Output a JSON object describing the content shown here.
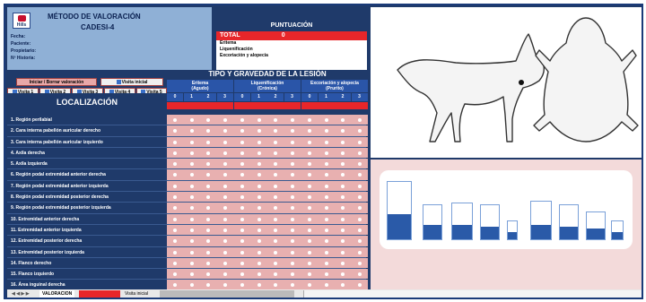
{
  "header": {
    "title": "MÉTODO DE VALORACIÓN",
    "subtitle": "CADESI-4",
    "logo_text": "Hills",
    "patient_info": [
      "Fecha:",
      "Paciente:",
      "Propietario:",
      "Nº Historia:"
    ]
  },
  "score": {
    "title": "PUNTUACIÓN",
    "total_label": "TOTAL",
    "total_value": "0",
    "items": [
      "Eritema",
      "Liquenificación",
      "Excoriación y alopecia"
    ]
  },
  "buttons": {
    "reset": "Iniciar / Borrar valoración",
    "initial": "Visita inicial",
    "visits": [
      "Visita 1",
      "Visita 2",
      "Visita 3",
      "Visita 4",
      "Visita 5"
    ]
  },
  "location_header": "LOCALIZACIÓN",
  "lesion_header": "TIPO Y GRAVEDAD DE LA LESIÓN",
  "groups": [
    {
      "name": "Eritema",
      "sub": "(Agudo)"
    },
    {
      "name": "Liquenificación",
      "sub": "(Crónica)"
    },
    {
      "name": "Excoriación y alopecia",
      "sub": "(Prurito)"
    }
  ],
  "scale": [
    "0",
    "1",
    "2",
    "3"
  ],
  "regions": [
    "1. Región perilabial",
    "2. Cara interna pabellón auricular derecho",
    "3. Cara interna pabellón auricular izquierdo",
    "4. Axila derecha",
    "5. Axila izquierda",
    "6. Región podal extremidad anterior derecha",
    "7. Región podal extremidad anterior izquierda",
    "8. Región podal extremidad posterior derecha",
    "9. Región podal extremidad posterior izquierda",
    "10. Extremidad anterior derecha",
    "11. Extremidad anterior izquierda",
    "12. Extremidad posterior derecha",
    "13. Extremidad posterior izquierda",
    "14. Flanco derecho",
    "15. Flanco izquierdo",
    "16. Área inguinal derecha"
  ],
  "sheet_tabs": [
    "VALORACION",
    "Visita inicial"
  ],
  "colors": {
    "navy": "#1f3a6a",
    "red": "#e8262a",
    "pink": "#e8b0b0"
  }
}
